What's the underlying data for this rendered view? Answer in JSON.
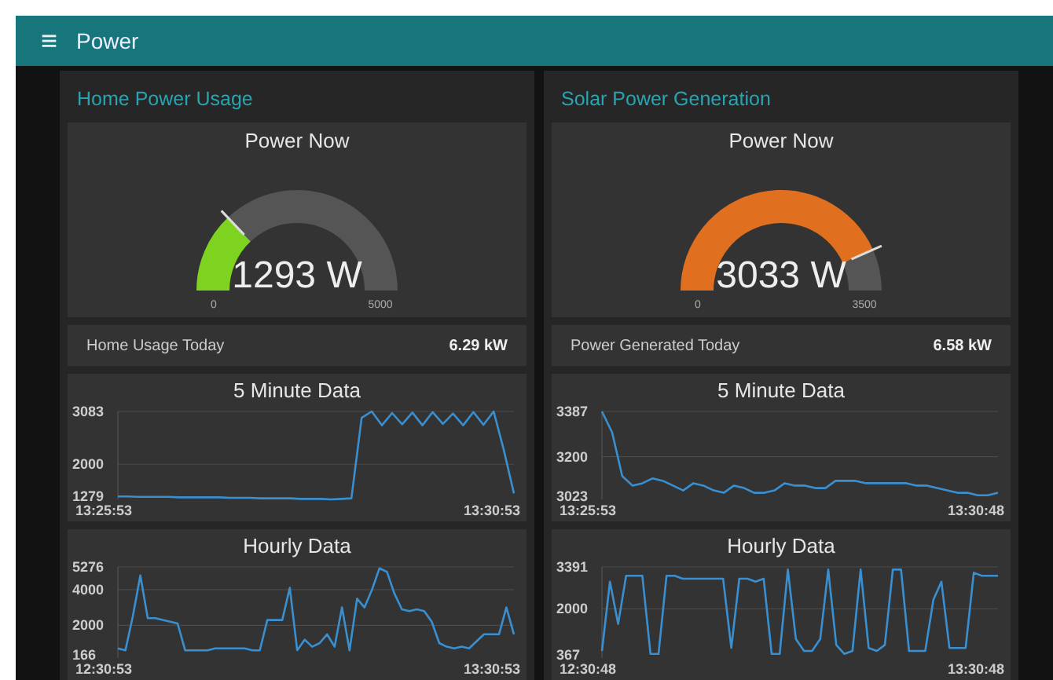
{
  "header": {
    "menu_icon": "≡",
    "title": "Power"
  },
  "groups": [
    {
      "title": "Home Power Usage",
      "gauge": {
        "title": "Power Now",
        "reading": "1293 W",
        "min": "0",
        "max": "5000",
        "color": "#7ed321"
      },
      "stat": {
        "label": "Home Usage Today",
        "value": "6.29 kW"
      },
      "charts": [
        {
          "title": "5 Minute Data",
          "x_start": "13:25:53",
          "x_end": "13:30:53",
          "chart_data": {
            "type": "line",
            "ylim": [
              1279,
              3083
            ],
            "yticks": [
              1279,
              2000,
              3083
            ],
            "series": [
              {
                "color": "#3a8fd0",
                "values": [
                  1340,
                  1340,
                  1330,
                  1330,
                  1330,
                  1330,
                  1320,
                  1320,
                  1320,
                  1320,
                  1320,
                  1310,
                  1310,
                  1310,
                  1300,
                  1300,
                  1300,
                  1300,
                  1290,
                  1290,
                  1290,
                  1280,
                  1290,
                  1300,
                  2950,
                  3083,
                  2800,
                  3050,
                  2820,
                  3060,
                  2800,
                  3070,
                  2830,
                  3040,
                  2800,
                  3070,
                  2810,
                  3083,
                  2300,
                  1400
                ]
              }
            ]
          }
        },
        {
          "title": "Hourly Data",
          "x_start": "12:30:53",
          "x_end": "13:30:53",
          "chart_data": {
            "type": "line",
            "ylim": [
              166,
              5276
            ],
            "yticks": [
              166,
              2000,
              4000,
              5276
            ],
            "series": [
              {
                "color": "#3a8fd0",
                "values": [
                  700,
                  600,
                  2500,
                  4800,
                  2400,
                  2400,
                  2300,
                  2200,
                  2100,
                  600,
                  600,
                  600,
                  600,
                  700,
                  700,
                  700,
                  700,
                  700,
                  600,
                  600,
                  2300,
                  2300,
                  2300,
                  4100,
                  600,
                  1200,
                  800,
                  1000,
                  1500,
                  800,
                  3000,
                  600,
                  3500,
                  3000,
                  4000,
                  5200,
                  5000,
                  3800,
                  2900,
                  2800,
                  2900,
                  2800,
                  2200,
                  1000,
                  800,
                  700,
                  800,
                  700,
                  1100,
                  1500,
                  1500,
                  1500,
                  3000,
                  1500
                ]
              }
            ]
          }
        }
      ]
    },
    {
      "title": "Solar Power Generation",
      "gauge": {
        "title": "Power Now",
        "reading": "3033 W",
        "min": "0",
        "max": "3500",
        "color": "#e07020"
      },
      "stat": {
        "label": "Power Generated Today",
        "value": "6.58 kW"
      },
      "charts": [
        {
          "title": "5 Minute Data",
          "x_start": "13:25:53",
          "x_end": "13:30:48",
          "chart_data": {
            "type": "line",
            "ylim": [
              3023,
              3387
            ],
            "yticks": [
              3023,
              3200,
              3387
            ],
            "series": [
              {
                "color": "#3a8fd0",
                "values": [
                  3387,
                  3300,
                  3120,
                  3080,
                  3090,
                  3110,
                  3100,
                  3080,
                  3060,
                  3090,
                  3080,
                  3060,
                  3050,
                  3080,
                  3070,
                  3050,
                  3050,
                  3060,
                  3090,
                  3080,
                  3080,
                  3070,
                  3070,
                  3100,
                  3100,
                  3100,
                  3090,
                  3090,
                  3090,
                  3090,
                  3090,
                  3080,
                  3080,
                  3070,
                  3060,
                  3050,
                  3050,
                  3040,
                  3040,
                  3050
                ]
              }
            ]
          }
        },
        {
          "title": "Hourly Data",
          "x_start": "12:30:48",
          "x_end": "13:30:48",
          "chart_data": {
            "type": "line",
            "ylim": [
              367,
              3391
            ],
            "yticks": [
              367,
              2000,
              3391
            ],
            "series": [
              {
                "color": "#3a8fd0",
                "values": [
                  600,
                  2900,
                  1500,
                  3100,
                  3100,
                  3100,
                  500,
                  500,
                  3100,
                  3100,
                  3000,
                  3000,
                  3000,
                  3000,
                  3000,
                  3000,
                  700,
                  3000,
                  3000,
                  2900,
                  3000,
                  500,
                  500,
                  3300,
                  1000,
                  600,
                  600,
                  1000,
                  3300,
                  800,
                  500,
                  600,
                  3300,
                  700,
                  600,
                  800,
                  3300,
                  3300,
                  600,
                  600,
                  600,
                  2300,
                  2900,
                  700,
                  700,
                  700,
                  3200,
                  3100,
                  3100,
                  3100
                ]
              }
            ]
          }
        }
      ]
    }
  ]
}
